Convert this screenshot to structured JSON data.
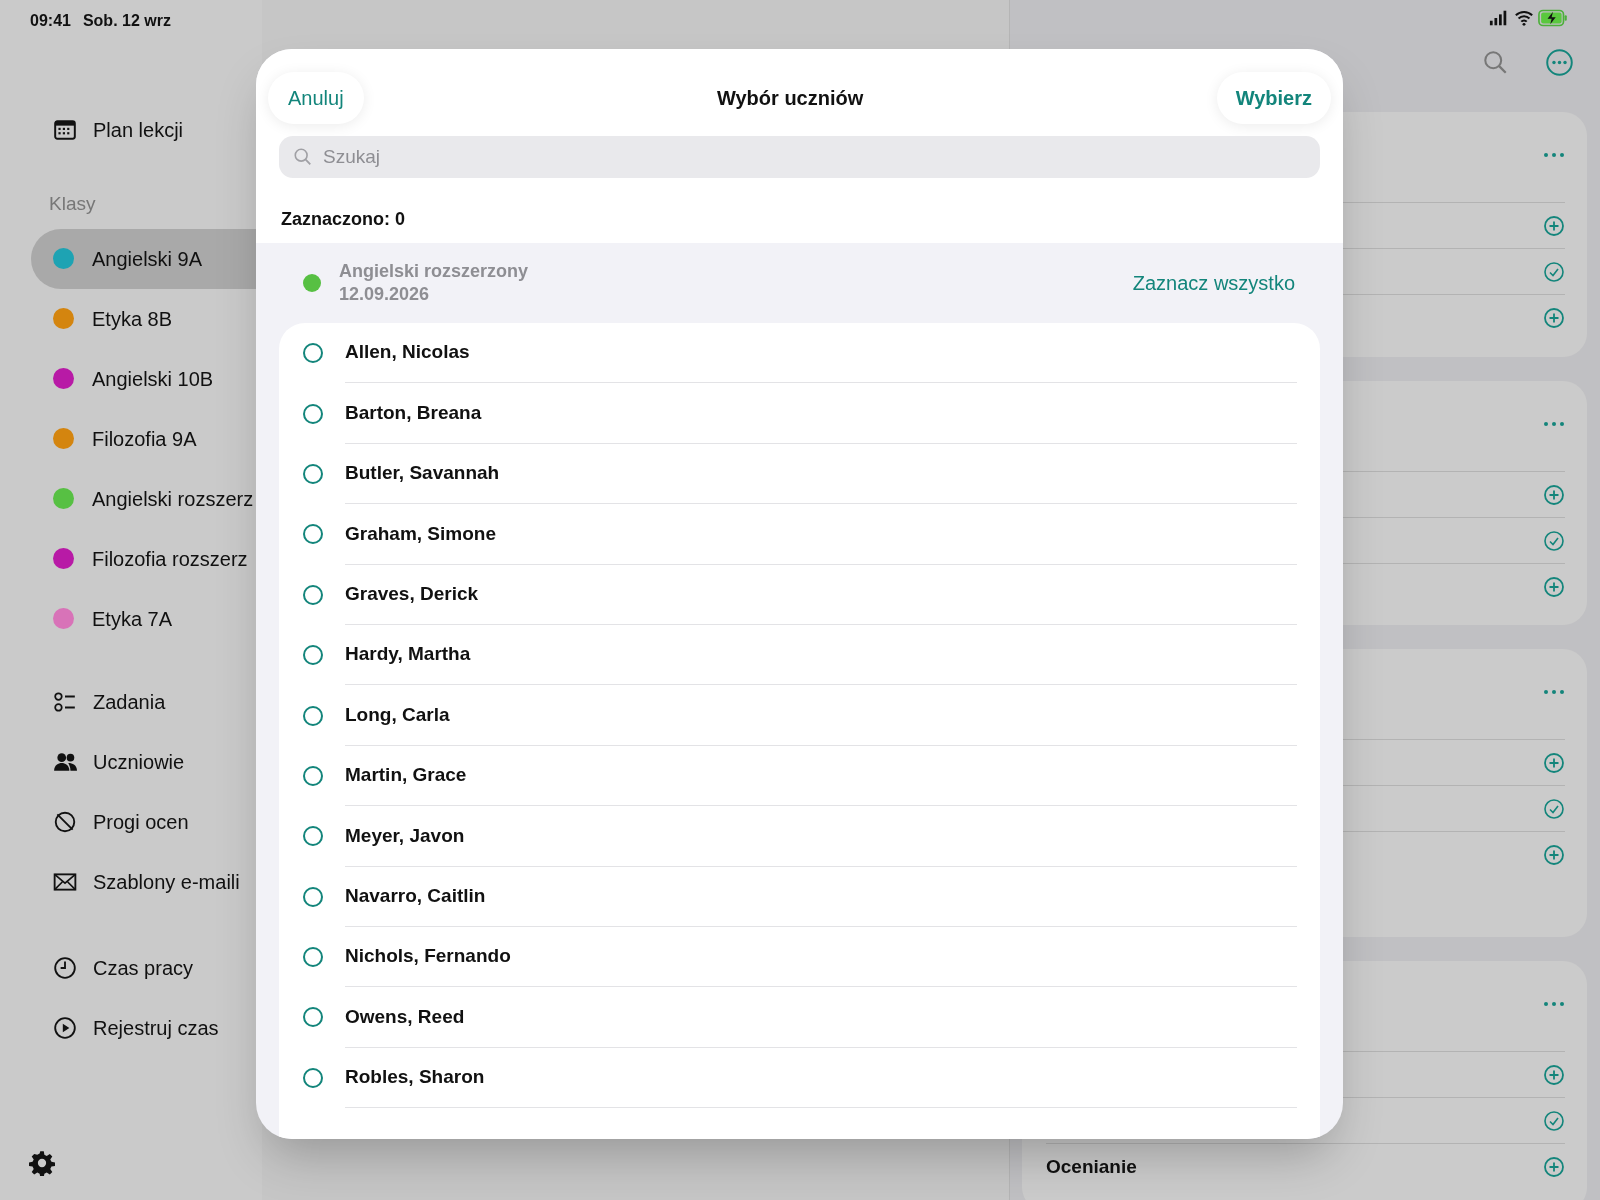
{
  "status_bar": {
    "time": "09:41",
    "date": "Sob. 12 wrz"
  },
  "sidebar": {
    "top_items": [
      {
        "label": "Plan lekcji"
      }
    ],
    "section_title": "Klasy",
    "classes": [
      {
        "label": "Angielski 9A",
        "color": "#1ea3b3",
        "selected": true
      },
      {
        "label": "Etyka 8B",
        "color": "#d4850f",
        "selected": false
      },
      {
        "label": "Angielski 10B",
        "color": "#b81aa6",
        "selected": false
      },
      {
        "label": "Filozofia 9A",
        "color": "#d4850f",
        "selected": false
      },
      {
        "label": "Angielski rozszerz",
        "color": "#57c043",
        "selected": false
      },
      {
        "label": "Filozofia rozszerz",
        "color": "#b81aa6",
        "selected": false
      },
      {
        "label": "Etyka 7A",
        "color": "#d873b8",
        "selected": false
      }
    ],
    "tools": [
      {
        "label": "Zadania"
      },
      {
        "label": "Uczniowie"
      },
      {
        "label": "Progi ocen"
      },
      {
        "label": "Szablony e-maili"
      }
    ],
    "time_items": [
      {
        "label": "Czas pracy"
      },
      {
        "label": "Rejestruj czas"
      }
    ]
  },
  "right_panel": {
    "cards": [
      {
        "rows": [
          {
            "kind": "add"
          },
          {
            "kind": "done"
          },
          {
            "kind": "add"
          }
        ]
      },
      {
        "rows": [
          {
            "kind": "add"
          },
          {
            "kind": "done"
          },
          {
            "kind": "add"
          }
        ]
      },
      {
        "rows": [
          {
            "kind": "add"
          },
          {
            "kind": "done"
          },
          {
            "kind": "add"
          }
        ]
      },
      {
        "rows": [
          {
            "kind": "add"
          },
          {
            "kind": "done"
          },
          {
            "kind": "add",
            "label": "Ocenianie"
          }
        ]
      }
    ]
  },
  "modal": {
    "cancel": "Anuluj",
    "title": "Wybór uczniów",
    "confirm": "Wybierz",
    "search": {
      "placeholder": "Szukaj"
    },
    "selected_count": "Zaznaczono: 0",
    "group": {
      "title": "Angielski rozszerzony",
      "date": "12.09.2026",
      "color": "#57c043",
      "select_all": "Zaznacz wszystko"
    },
    "students": [
      {
        "name": "Allen, Nicolas",
        "selected": false
      },
      {
        "name": "Barton, Breana",
        "selected": false
      },
      {
        "name": "Butler, Savannah",
        "selected": false
      },
      {
        "name": "Graham, Simone",
        "selected": false
      },
      {
        "name": "Graves, Derick",
        "selected": false
      },
      {
        "name": "Hardy, Martha",
        "selected": false
      },
      {
        "name": "Long, Carla",
        "selected": false
      },
      {
        "name": "Martin, Grace",
        "selected": false
      },
      {
        "name": "Meyer, Javon",
        "selected": false
      },
      {
        "name": "Navarro, Caitlin",
        "selected": false
      },
      {
        "name": "Nichols, Fernando",
        "selected": false
      },
      {
        "name": "Owens, Reed",
        "selected": false
      },
      {
        "name": "Robles, Sharon",
        "selected": false
      }
    ]
  }
}
